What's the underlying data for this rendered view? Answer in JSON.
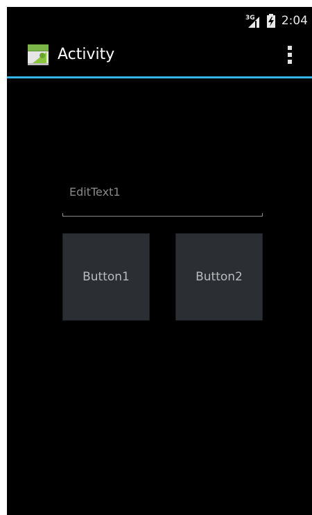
{
  "status_bar": {
    "network_label": "3G",
    "time": "2:04",
    "icons": [
      "signal-3g-icon",
      "battery-charging-icon"
    ]
  },
  "action_bar": {
    "title": "Activity",
    "app_icon": "android-app-icon",
    "overflow_icon": "overflow-menu-icon",
    "divider_color": "#33b5e5"
  },
  "content": {
    "edit_text": {
      "value": "",
      "placeholder": "EditText1"
    },
    "buttons": [
      {
        "label": "Button1"
      },
      {
        "label": "Button2"
      }
    ]
  }
}
